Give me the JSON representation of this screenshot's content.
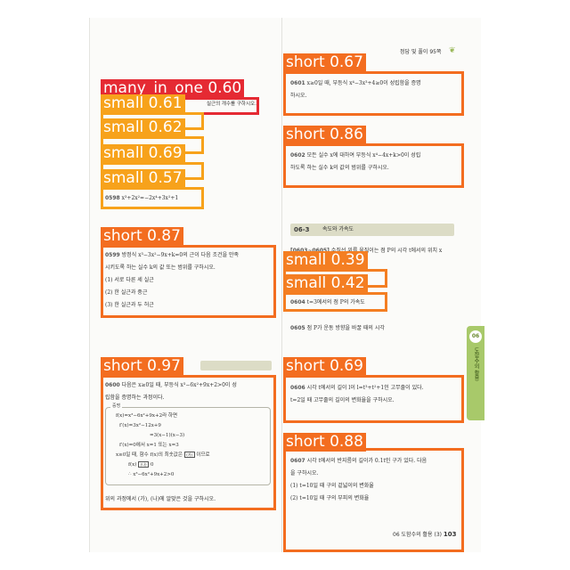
{
  "page": {
    "header": "정답 및 풀이 95쪽",
    "footer_section": "06 도함수의 활용 (3)",
    "footer_page": "103"
  },
  "section": {
    "number": "06-3",
    "title": "속도와 가속도"
  },
  "side_tab": {
    "number": "06",
    "label": "도함수의 활용"
  },
  "problems": {
    "p_small_top": "실근의 개수를 구하시오.",
    "p0598": {
      "num": "0598",
      "text": "x³+2x²=−2x⁴+3x²+1"
    },
    "p0599": {
      "num": "0599",
      "lines": [
        "방정식 x³−3x²−9x+k=0의 근이 다음 조건을 만족",
        "시키도록 하는 실수 k의 값 또는 범위를 구하시오."
      ],
      "items": [
        "(1) 서로 다른 세 실근",
        "(2) 한 실근과 중근",
        "(3) 한 실근과 두 허근"
      ]
    },
    "p0600": {
      "num": "0600",
      "lines": [
        "다음은 x≥0일 때, 부등식 x³−6x²+9x+2>0이 성",
        "립함을 증명하는 과정이다."
      ],
      "proof_tag": "증명",
      "proof": [
        "f(x)=x³−6x²+9x+2라 하면",
        "f′(x)=3x²−12x+9",
        "=3(x−1)(x−3)",
        "f′(x)=0에서    x=1 또는 x=3",
        "x≥0일 때, 함수 f(x)의 최솟값은",
        "f(x)",
        "∴ x³−6x²+9x+2>0"
      ],
      "blank_a": "(가)",
      "blank_b": "(나)",
      "proof_suffix_a": "이므로",
      "proof_suffix_b": "0",
      "footer_text": "위의 과정에서 (가), (나)에 알맞은 것을 구하시오."
    },
    "p0601": {
      "num": "0601",
      "lines": [
        "x≥0일 때, 부등식 x⁴−3x³+4≥0이 성립함을 증명",
        "하시오."
      ]
    },
    "p0602": {
      "num": "0602",
      "lines": [
        "모든 실수 x에 대하여 부등식 x⁴−4x+k>0이 성립",
        "하도록 하는 실수 k의 값의 범위를 구하시오."
      ]
    },
    "p0603": {
      "num": "[0603~0605]",
      "lines": [
        "수직선 위를 움직이는 점 P의 시각 t에서의 위치 x"
      ]
    },
    "p0604": {
      "num": "0604",
      "text": "t=3에서의 점 P의 가속도"
    },
    "p0605": {
      "num": "0605",
      "text": "점 P가 운동 방향을 바꿀 때의 시각"
    },
    "p0606": {
      "num": "0606",
      "lines": [
        "시각 t에서의 길이 l이 l=t³+t²+1인 고무줄이 있다.",
        "t=2일 때 고무줄의 길이의 변화율을 구하시오."
      ]
    },
    "p0607": {
      "num": "0607",
      "lines": [
        "시각 t에서의 반지름의 길이가 0.1t인 구가 있다. 다음",
        "을 구하시오."
      ],
      "items": [
        "(1) t=10일 때 구의 겉넓이의 변화율",
        "(2) t=10일 때 구의 부피의 변화율"
      ]
    }
  },
  "detections": [
    {
      "label": "many_in_one 0.60"
    },
    {
      "label": "small 0.61"
    },
    {
      "label": "small 0.62"
    },
    {
      "label": "small 0.69"
    },
    {
      "label": "small 0.57"
    },
    {
      "label": "short 0.87"
    },
    {
      "label": "short 0.97"
    },
    {
      "label": "short 0.67"
    },
    {
      "label": "short 0.86"
    },
    {
      "label": "small 0.39"
    },
    {
      "label": "small 0.42"
    },
    {
      "label": "short 0.69"
    },
    {
      "label": "short 0.88"
    }
  ],
  "colors": {
    "many_in_one": "#e52a33",
    "small_high": "#f7a21b",
    "small_low": "#f47e22",
    "short": "#f36d20",
    "side_tab": "#a8c96a"
  }
}
